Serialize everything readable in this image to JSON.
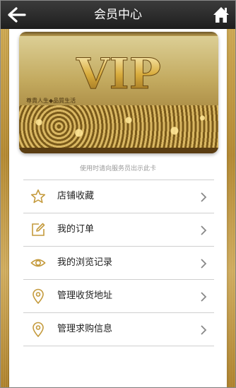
{
  "header": {
    "title": "会员中心",
    "back_icon": "back-arrow-icon",
    "home_icon": "home-icon"
  },
  "card": {
    "brand": "VIP",
    "slogan": "尊貴人生◆品質生活"
  },
  "hint": "使用时请向服务员出示此卡",
  "menu": {
    "items": [
      {
        "label": "店铺收藏",
        "icon": "star-icon"
      },
      {
        "label": "我的订单",
        "icon": "edit-icon"
      },
      {
        "label": "我的浏览记录",
        "icon": "eye-icon"
      },
      {
        "label": "管理收货地址",
        "icon": "location-pin-icon"
      },
      {
        "label": "管理求购信息",
        "icon": "location-pin-icon"
      }
    ]
  },
  "colors": {
    "accent": "#c49a3c",
    "header_bg": "#2b2b2b",
    "text": "#222222"
  }
}
